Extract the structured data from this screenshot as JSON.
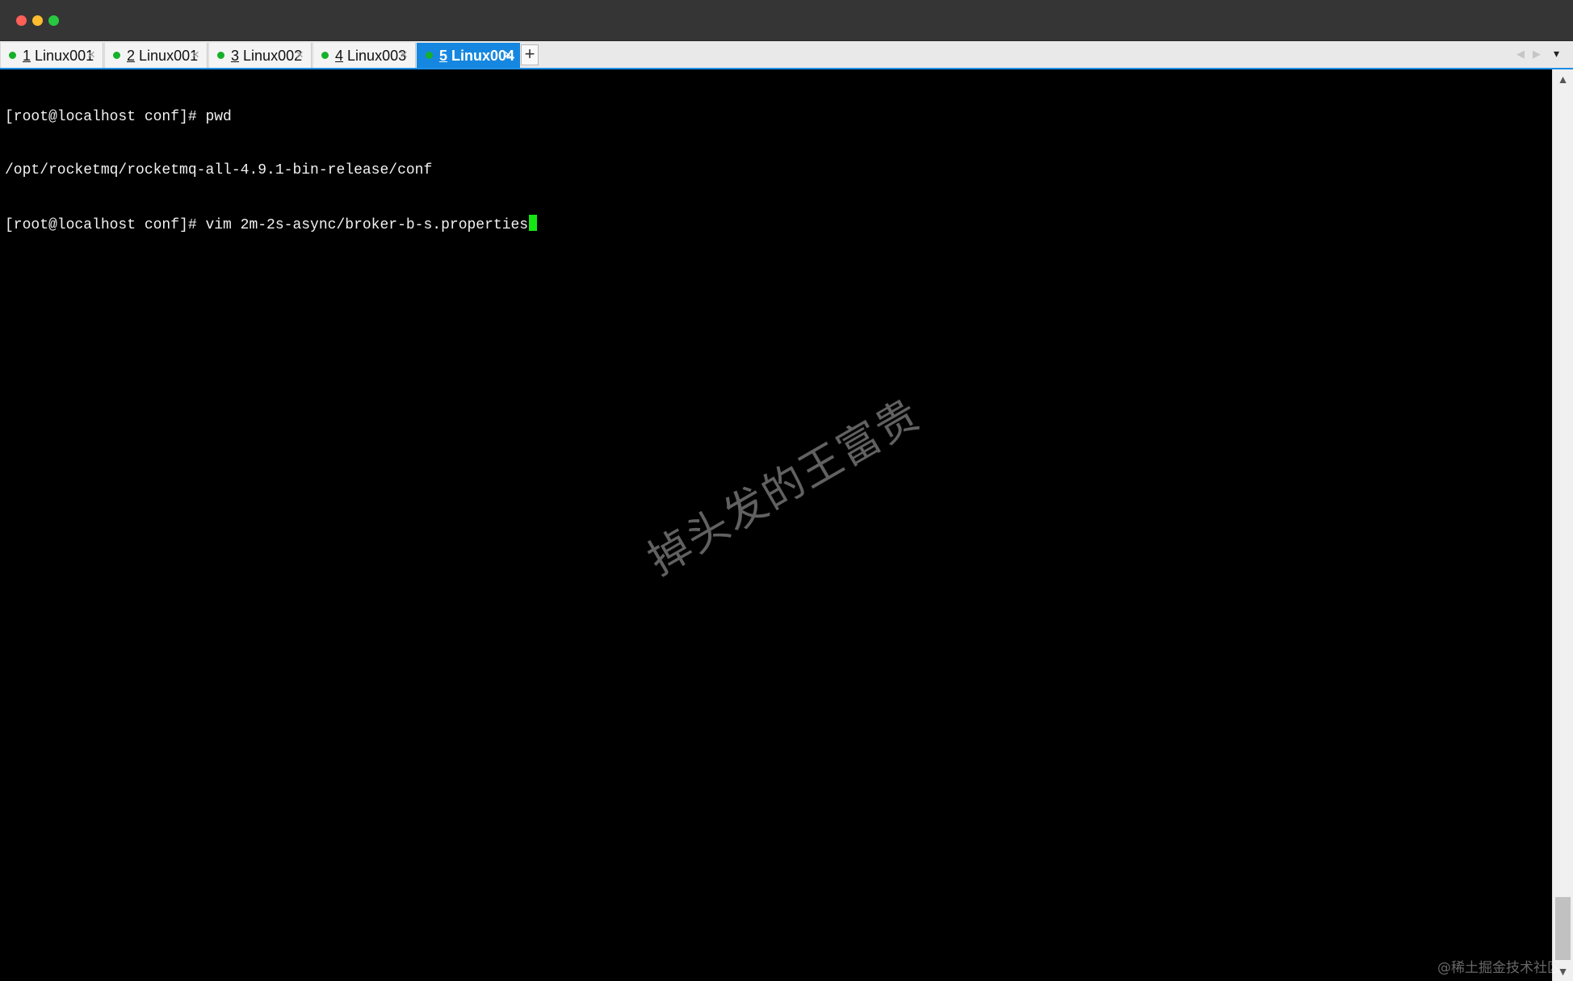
{
  "tabs": [
    {
      "num": "1",
      "label": "Linux001",
      "close": "×",
      "active": false
    },
    {
      "num": "2",
      "label": "Linux001",
      "close": "×",
      "active": false
    },
    {
      "num": "3",
      "label": "Linux002",
      "close": "×",
      "active": false
    },
    {
      "num": "4",
      "label": "Linux003",
      "close": "×",
      "active": false
    },
    {
      "num": "5",
      "label": "Linux004",
      "close": "×",
      "active": true
    }
  ],
  "tabbar": {
    "new_tab": "+",
    "nav_left": "◀",
    "nav_right": "▶",
    "menu": "▾"
  },
  "terminal": {
    "lines": [
      "[root@localhost conf]# pwd",
      "/opt/rocketmq/rocketmq-all-4.9.1-bin-release/conf",
      "[root@localhost conf]# vim 2m-2s-async/broker-b-s.properties"
    ]
  },
  "scrollbar": {
    "up": "▲",
    "down": "▼"
  },
  "watermark": "掉头发的王富贵",
  "footer_mark": "@稀土掘金技术社区",
  "colors": {
    "titlebar": "#353535",
    "tab_active": "#1587e0",
    "status_dot": "#16b12a",
    "cursor": "#14e614",
    "terminal_bg": "#000000",
    "terminal_fg": "#f2f2f2"
  }
}
